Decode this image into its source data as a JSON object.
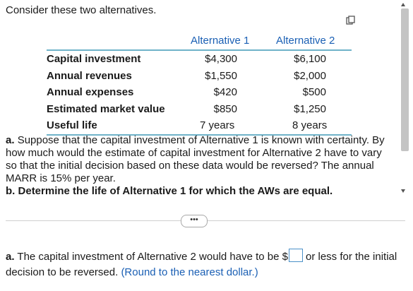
{
  "intro": "Consider these two alternatives.",
  "table": {
    "headers": [
      "Alternative 1",
      "Alternative 2"
    ],
    "rows": [
      {
        "label": "Capital investment",
        "alt1": "$4,300",
        "alt2": "$6,100"
      },
      {
        "label": "Annual revenues",
        "alt1": "$1,550",
        "alt2": "$2,000"
      },
      {
        "label": "Annual expenses",
        "alt1": "$420",
        "alt2": "$500"
      },
      {
        "label": "Estimated market value",
        "alt1": "$850",
        "alt2": "$1,250"
      },
      {
        "label": "Useful life",
        "alt1": "7 years",
        "alt2": "8 years"
      }
    ]
  },
  "question": {
    "part_a_label": "a.",
    "part_a_text": "Suppose that the capital investment of Alternative 1 is known with certainty. By how much would the estimate of capital investment for Alternative 2 have to vary so that the initial decision based on these data would be reversed? The annual MARR is 15% per year.",
    "part_b_label": "b.",
    "part_b_text": "Determine the life of Alternative 1 for which the AWs are equal."
  },
  "more_button": "•••",
  "answer": {
    "label": "a.",
    "text_before": "The capital investment of Alternative 2 would have to be $",
    "text_after": "or less for the initial decision to be reversed.",
    "hint": "(Round to the nearest dollar.)"
  }
}
